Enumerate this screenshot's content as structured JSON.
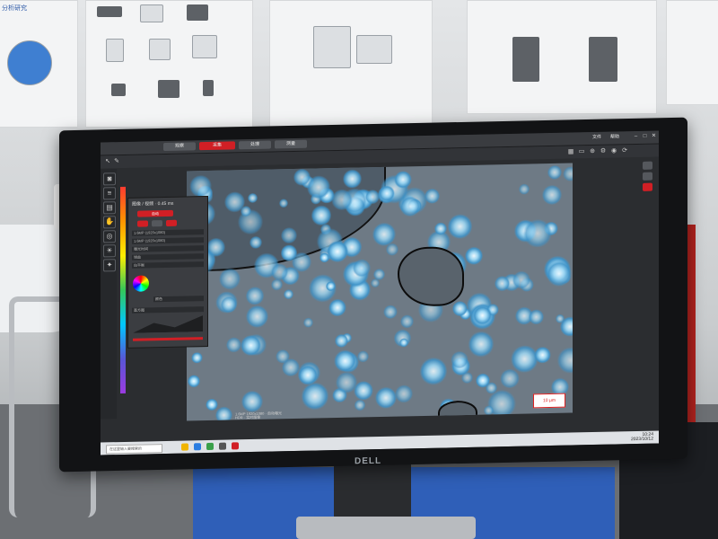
{
  "app": {
    "tabs": [
      {
        "label": "观察",
        "active": false
      },
      {
        "label": "采集",
        "active": true
      },
      {
        "label": "处理",
        "active": false
      },
      {
        "label": "测量",
        "active": false
      }
    ],
    "top_right": {
      "file_label": "文件",
      "help_label": "帮助"
    },
    "panel": {
      "title": "图像 / 视频 · 0.45 ms",
      "mode_button": "自动",
      "rows": [
        "1.6MP (1920x1080)",
        "1.6MP (1920x1080)",
        "曝光时间",
        "增益",
        "白平衡"
      ],
      "section_label": "颜色",
      "histogram_label": "直方图"
    },
    "scalebar_label": "10 μm",
    "status_lines": [
      "1.6MP 1920x1080 · 自动曝光",
      "HDR · 实时图像"
    ]
  },
  "taskbar": {
    "search_placeholder": "在这里输入要搜索的",
    "time": "10:24",
    "date": "2023/10/12"
  },
  "booth": {
    "brand_label": "DELL"
  },
  "colors": {
    "accent": "#d11f25",
    "app_bg": "#2b2d30",
    "crystal": "#9fd9f5"
  }
}
